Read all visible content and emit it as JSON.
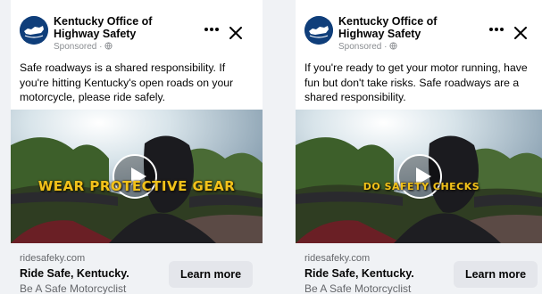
{
  "ads": [
    {
      "page_name": "Kentucky Office of Highway Safety",
      "sponsored": "Sponsored · ",
      "body": "Safe roadways is a shared responsibility. If you're hitting Kentucky's open roads on your motorcycle, please ride safely.",
      "video_overlay": "WEAR PROTECTIVE GEAR",
      "domain": "ridesafeky.com",
      "headline": "Ride Safe, Kentucky.",
      "description": "Be A Safe Motorcyclist",
      "cta": "Learn more"
    },
    {
      "page_name": "Kentucky Office of Highway Safety",
      "sponsored": "Sponsored · ",
      "body": "If you're ready to get your motor running, have fun but don't take risks. Safe roadways are a shared responsibility.",
      "video_overlay": "DO SAFETY CHECKS",
      "domain": "ridesafeky.com",
      "headline": "Ride Safe, Kentucky.",
      "description": "Be A Safe Motorcyclist",
      "cta": "Learn more"
    }
  ],
  "icons": {
    "avatar": "kentucky-logo-icon",
    "audience": "globe-icon",
    "more": "more-horizontal-icon",
    "close": "close-icon",
    "play": "play-icon"
  },
  "colors": {
    "overlay_text": "#f2c21a",
    "cta_background": "#e4e6eb",
    "footer_background": "#f0f2f5",
    "secondary_text": "#65676b"
  }
}
